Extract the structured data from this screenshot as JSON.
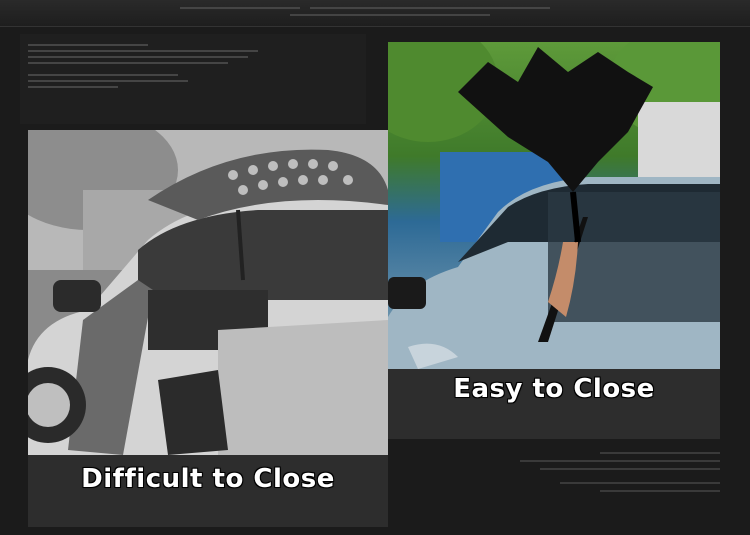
{
  "captions": {
    "difficult": "Difficult to Close",
    "easy": "Easy to Close"
  },
  "photos": {
    "left_icon": "umbrella-car-door-photo",
    "right_icon": "inverted-umbrella-car-photo"
  },
  "colors": {
    "background": "#1b1b1b",
    "caption_bg": "#2d2d2d",
    "caption_text": "#ffffff"
  }
}
